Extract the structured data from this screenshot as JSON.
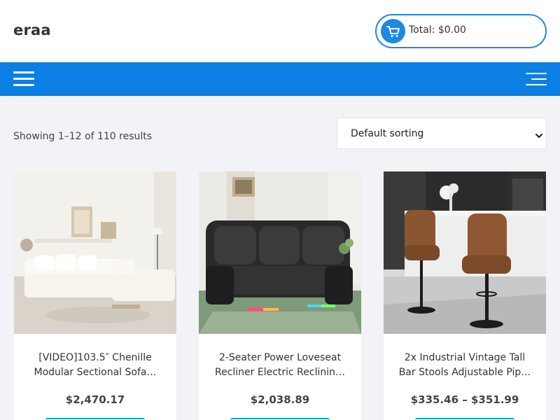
{
  "header": {
    "site_title": "eraa",
    "cart": {
      "total_label": "Total: $0.00",
      "icon": "shopping-cart-icon"
    }
  },
  "navbar": {
    "left_icon": "hamburger-menu-icon",
    "right_icon": "hamburger-menu-icon"
  },
  "shop": {
    "results_text": "Showing 1–12 of 110 results",
    "sorting": {
      "selected": "Default sorting"
    }
  },
  "products": [
    {
      "title_line1": "[VIDEO]103.5″ Chenille",
      "title_line2": "Modular Sectional Sofa…",
      "price": "$2,470.17",
      "image": "white-sectional-sofa"
    },
    {
      "title_line1": "2-Seater Power Loveseat",
      "title_line2": "Recliner Electric Reclinin…",
      "price": "$2,038.89",
      "image": "black-leather-loveseat-recliner"
    },
    {
      "title_line1": "2x Industrial Vintage Tall",
      "title_line2": "Bar Stools Adjustable Pip…",
      "price": "$335.46 – $351.99",
      "image": "brown-bar-stools"
    }
  ],
  "colors": {
    "accent": "#1e88e5",
    "navbar": "#0b7fe4",
    "page_bg": "#f2f3f7",
    "button_accent": "#11a3b4"
  }
}
